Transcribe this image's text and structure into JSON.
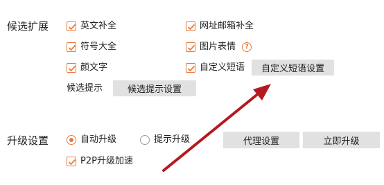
{
  "candidate_expansion": {
    "title": "候选扩展",
    "options": [
      {
        "label": "英文补全",
        "checked": true
      },
      {
        "label": "网址邮箱补全",
        "checked": true
      },
      {
        "label": "符号大全",
        "checked": true
      },
      {
        "label": "图片表情",
        "checked": true
      },
      {
        "label": "颜文字",
        "checked": true
      },
      {
        "label": "自定义短语",
        "checked": true
      }
    ],
    "custom_phrase_settings_button": "自定义短语设置",
    "candidate_hint_label": "候选提示",
    "candidate_hint_settings_button": "候选提示设置",
    "help_icon": "help-question-icon"
  },
  "upgrade_settings": {
    "title": "升级设置",
    "mode_options": [
      {
        "label": "自动升级",
        "selected": true
      },
      {
        "label": "提示升级",
        "selected": false
      }
    ],
    "proxy_settings_button": "代理设置",
    "upgrade_now_button": "立即升级",
    "p2p_label": "P2P升级加速",
    "p2p_checked": true
  },
  "colors": {
    "accent": "#e8793a",
    "button_bg": "#e1e1e1",
    "annotation_arrow": "#b5191f"
  }
}
